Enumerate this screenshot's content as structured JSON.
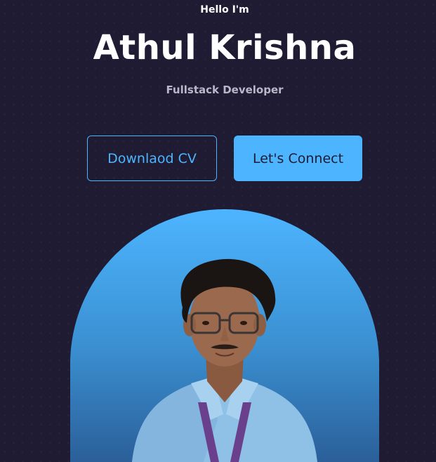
{
  "hero": {
    "greeting": "Hello I'm",
    "name": "Athul Krishna",
    "role": "Fullstack Developer"
  },
  "buttons": {
    "download_cv": "Downlaod CV",
    "connect": "Let's Connect"
  },
  "colors": {
    "background": "#1f1b33",
    "accent": "#4db5ff",
    "text": "#ffffff",
    "muted": "#b9b7c9"
  }
}
